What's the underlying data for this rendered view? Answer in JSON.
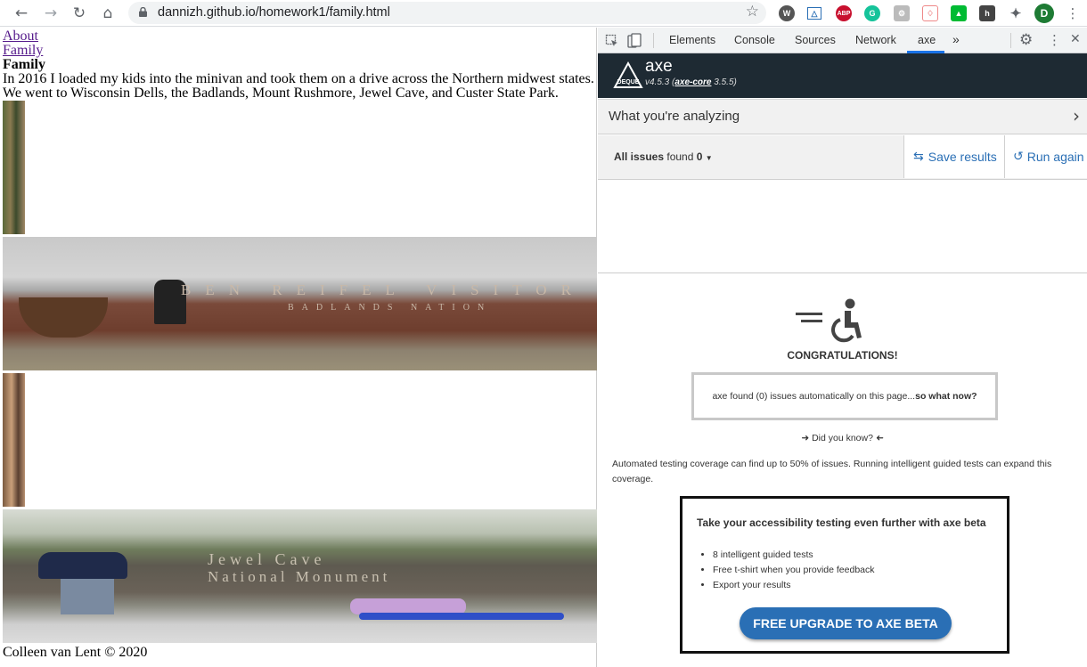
{
  "browser": {
    "url": "dannizh.github.io/homework1/family.html",
    "profile_initial": "D"
  },
  "page": {
    "nav_about": "About",
    "nav_family": "Family",
    "heading": "Family",
    "intro_line1": "In 2016 I loaded my kids into the minivan and took them on a drive across the Northern midwest states.",
    "intro_line2": "We went to Wisconsin Dells, the Badlands, Mount Rushmore, Jewel Cave, and Custer State Park.",
    "photo2_sign_line1": "BEN REIFEL VISITOR",
    "photo2_sign_line2": "BADLANDS NATION",
    "photo4_sign_line1": "Jewel Cave",
    "photo4_sign_line2": "National Monument",
    "footer": "Colleen van Lent © 2020"
  },
  "devtools": {
    "tabs": [
      "Elements",
      "Console",
      "Sources",
      "Network",
      "axe"
    ],
    "active_tab": "axe",
    "more": "»"
  },
  "axe": {
    "brand": "axe",
    "logo_text": "DEQUE",
    "version_prefix": "v4.5.3 (",
    "version_link": "axe-core",
    "version_suffix": " 3.5.5)",
    "analyzing_label": "What you're analyzing",
    "issues_label": "All issues",
    "found_label": "found",
    "found_count": "0",
    "save_results": "Save results",
    "run_again": "Run again",
    "congrats": "CONGRATULATIONS!",
    "summary_pre": "axe found (0) issues automatically on this page...",
    "summary_bold": "so what now?",
    "did_you_know": "Did you know?",
    "coverage_text": "Automated testing coverage can find up to 50% of issues. Running intelligent guided tests can expand this coverage.",
    "promo_title": "Take your accessibility testing even further with axe beta",
    "promo_items": [
      "8 intelligent guided tests",
      "Free t-shirt when you provide feedback",
      "Export your results"
    ],
    "upgrade_button": "FREE UPGRADE TO AXE BETA",
    "accent_color": "#2a6fb5",
    "header_bg": "#1e2a33"
  }
}
